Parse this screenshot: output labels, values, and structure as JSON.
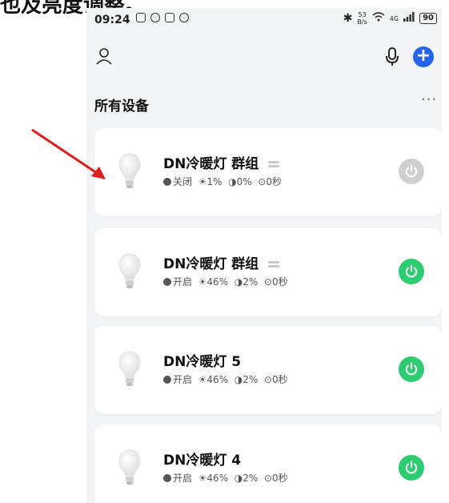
{
  "caption": "也及亮度调整。",
  "status_bar": {
    "time": "09:24",
    "net_speed_top": "53",
    "net_speed_bottom": "B/s",
    "network": "4G",
    "battery": "90"
  },
  "header": {
    "user_icon": "user-icon",
    "mic_icon": "microphone-icon",
    "add_icon": "plus-icon",
    "add_label": "+"
  },
  "section": {
    "title": "所有设备",
    "more_label": "···"
  },
  "colors": {
    "power_on": "#2ecc71",
    "power_off": "#cfcfcf",
    "accent": "#2563eb",
    "annotation_arrow": "#e11d1d"
  },
  "devices": [
    {
      "name": "DN冷暖灯 群组",
      "state": "关闭",
      "brightness": "1%",
      "color_temp": "0%",
      "timer": "0秒",
      "power_on": false,
      "is_group": true
    },
    {
      "name": "DN冷暖灯 群组",
      "state": "开启",
      "brightness": "46%",
      "color_temp": "2%",
      "timer": "0秒",
      "power_on": true,
      "is_group": true
    },
    {
      "name": "DN冷暖灯 5",
      "state": "开启",
      "brightness": "46%",
      "color_temp": "2%",
      "timer": "0秒",
      "power_on": true,
      "is_group": false
    },
    {
      "name": "DN冷暖灯 4",
      "state": "开启",
      "brightness": "46%",
      "color_temp": "2%",
      "timer": "0秒",
      "power_on": true,
      "is_group": false
    }
  ]
}
